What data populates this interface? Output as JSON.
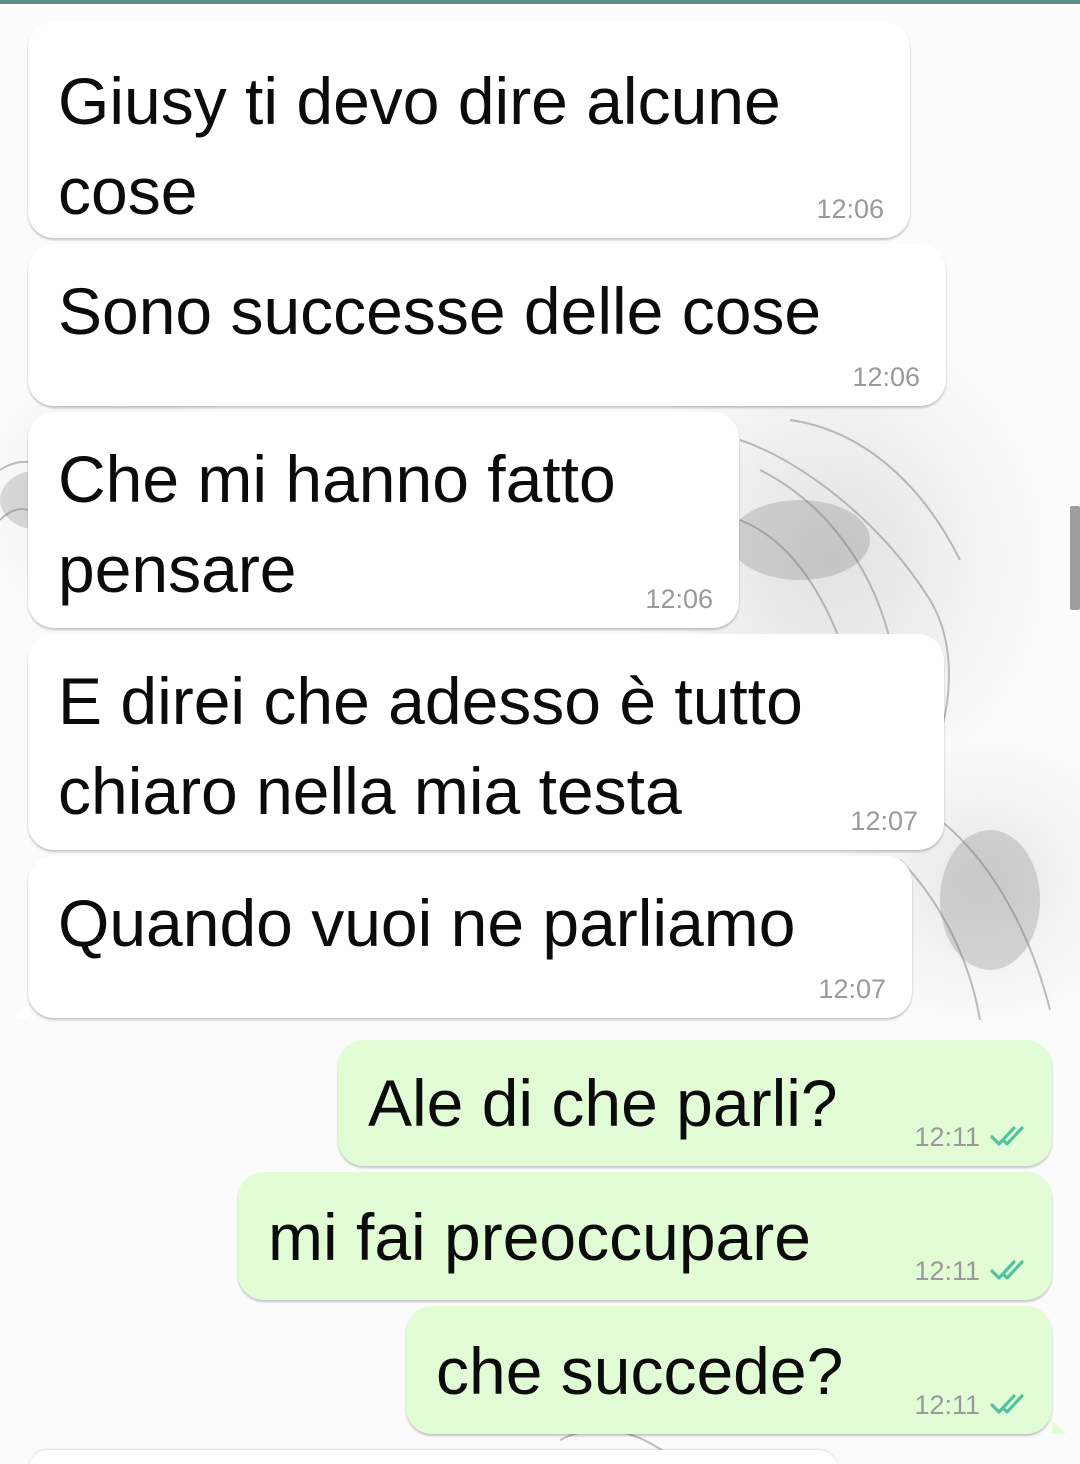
{
  "messages": [
    {
      "direction": "incoming",
      "text": "Giusy ti devo dire alcune\ncose",
      "time": "12:06"
    },
    {
      "direction": "incoming",
      "text": "Sono successe delle cose",
      "time": "12:06"
    },
    {
      "direction": "incoming",
      "text": "Che mi hanno fatto\npensare",
      "time": "12:06"
    },
    {
      "direction": "incoming",
      "text": "E direi che adesso è tutto\nchiaro nella mia testa",
      "time": "12:07"
    },
    {
      "direction": "incoming",
      "text": "Quando vuoi ne parliamo",
      "time": "12:07"
    },
    {
      "direction": "outgoing",
      "text": "Ale di che parli?",
      "time": "12:11",
      "status_icon": "double-check-icon"
    },
    {
      "direction": "outgoing",
      "text": "mi fai preoccupare",
      "time": "12:11",
      "status_icon": "double-check-icon"
    },
    {
      "direction": "outgoing",
      "text": "che succede?",
      "time": "12:11",
      "status_icon": "double-check-icon"
    }
  ],
  "colors": {
    "incoming_bubble": "#ffffff",
    "outgoing_bubble": "#e2fcd5",
    "read_ticks": "#4fc3a1",
    "top_accent": "#5d8f8a"
  }
}
